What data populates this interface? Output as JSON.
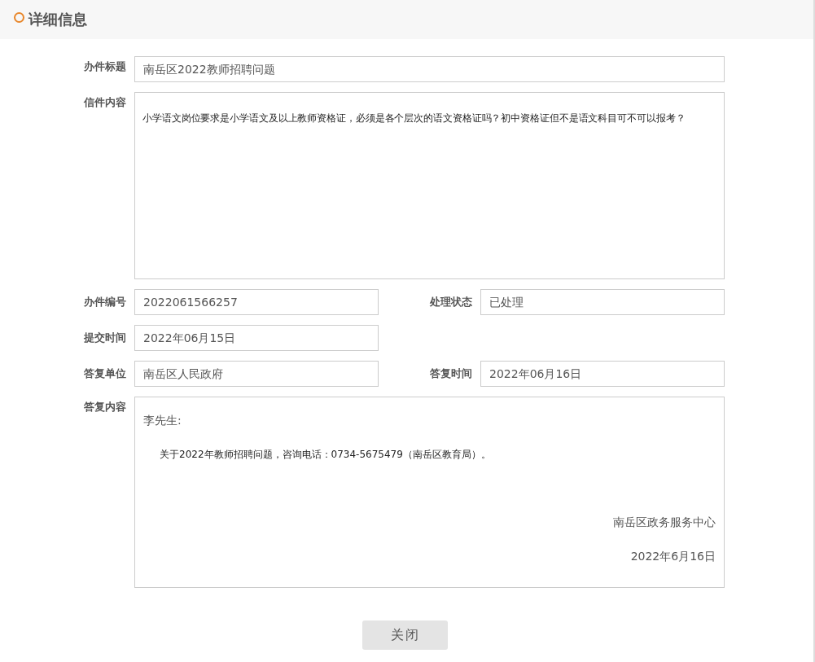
{
  "header": {
    "title": "详细信息"
  },
  "rows": [
    [
      {
        "kind": "wide_line",
        "label": "办件标题",
        "value": "南岳区2022教师招聘问题"
      }
    ],
    [
      {
        "kind": "multiline",
        "label": "信件内容",
        "value": "小学语文岗位要求是小学语文及以上教师资格证，必须是各个层次的语文资格证吗？初中资格证但不是语文科目可不可以报考？"
      }
    ],
    [
      {
        "kind": "line",
        "label": "办件编号",
        "value": "2022061566257"
      },
      {
        "kind": "line",
        "label": "处理状态",
        "value": "已处理"
      }
    ],
    [
      {
        "kind": "line",
        "label": "提交时间",
        "value": "2022年06月15日"
      }
    ],
    [
      {
        "kind": "line",
        "label": "答复单位",
        "value": "南岳区人民政府"
      },
      {
        "kind": "line",
        "label": "答复时间",
        "value": "2022年06月16日"
      }
    ],
    [
      {
        "kind": "letter",
        "label": "答复内容",
        "greeting": "李先生:",
        "body": "关于2022年教师招聘问题，咨询电话：0734-5675479（南岳区教育局）。",
        "signature": "南岳区政务服务中心",
        "date": "2022年6月16日"
      }
    ]
  ],
  "buttons": [
    {
      "label": "关闭"
    }
  ]
}
